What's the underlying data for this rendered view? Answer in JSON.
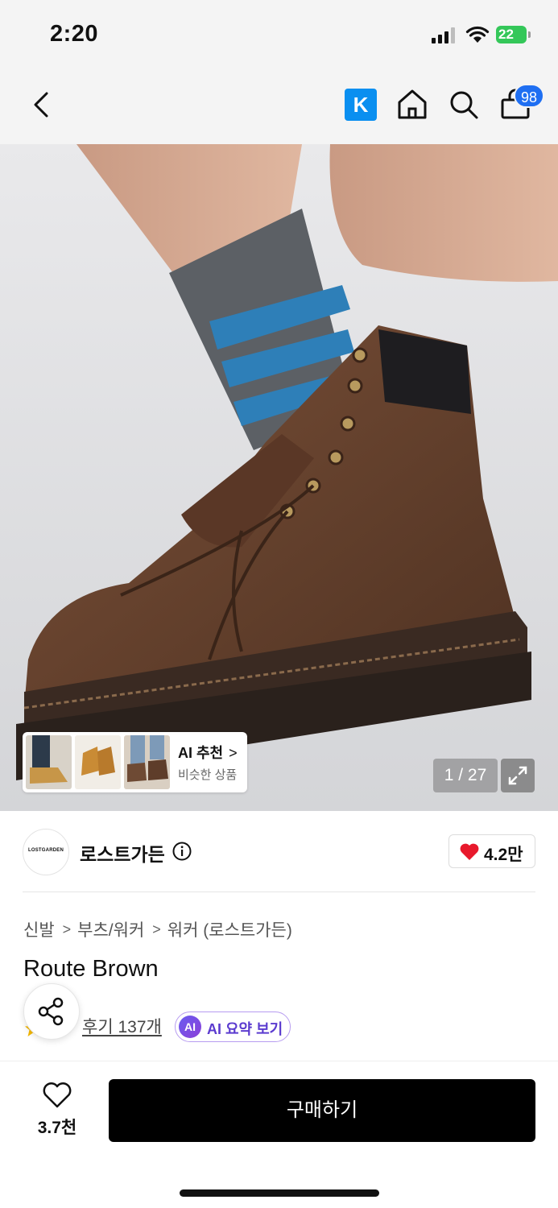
{
  "status_bar": {
    "time": "2:20",
    "battery": "22"
  },
  "nav": {
    "k_label": "K",
    "cart_badge": "98"
  },
  "product_image": {
    "ai_recommend_title": "AI 추천",
    "ai_recommend_chevron": ">",
    "ai_recommend_sub": "비슷한 상품",
    "counter": "1 / 27"
  },
  "brand": {
    "logo_text": "LOSTGARDEN",
    "name": "로스트가든",
    "like_count": "4.2만"
  },
  "breadcrumb": [
    "신발",
    "부츠/워커",
    "워커 (로스트가든)"
  ],
  "breadcrumb_sep": ">",
  "product": {
    "name": "Route Brown",
    "review_link": "후기 137개",
    "ai_badge": "AI",
    "ai_summary_label": "AI 요약 보기"
  },
  "bottom_bar": {
    "wish_count": "3.7천",
    "buy_label": "구매하기"
  },
  "colors": {
    "accent_blue": "#1f6ff2",
    "k_blue": "#0a8ff0",
    "heart_red": "#e8192c",
    "ai_purple": "#5b3bcf",
    "buy_black": "#000000"
  }
}
